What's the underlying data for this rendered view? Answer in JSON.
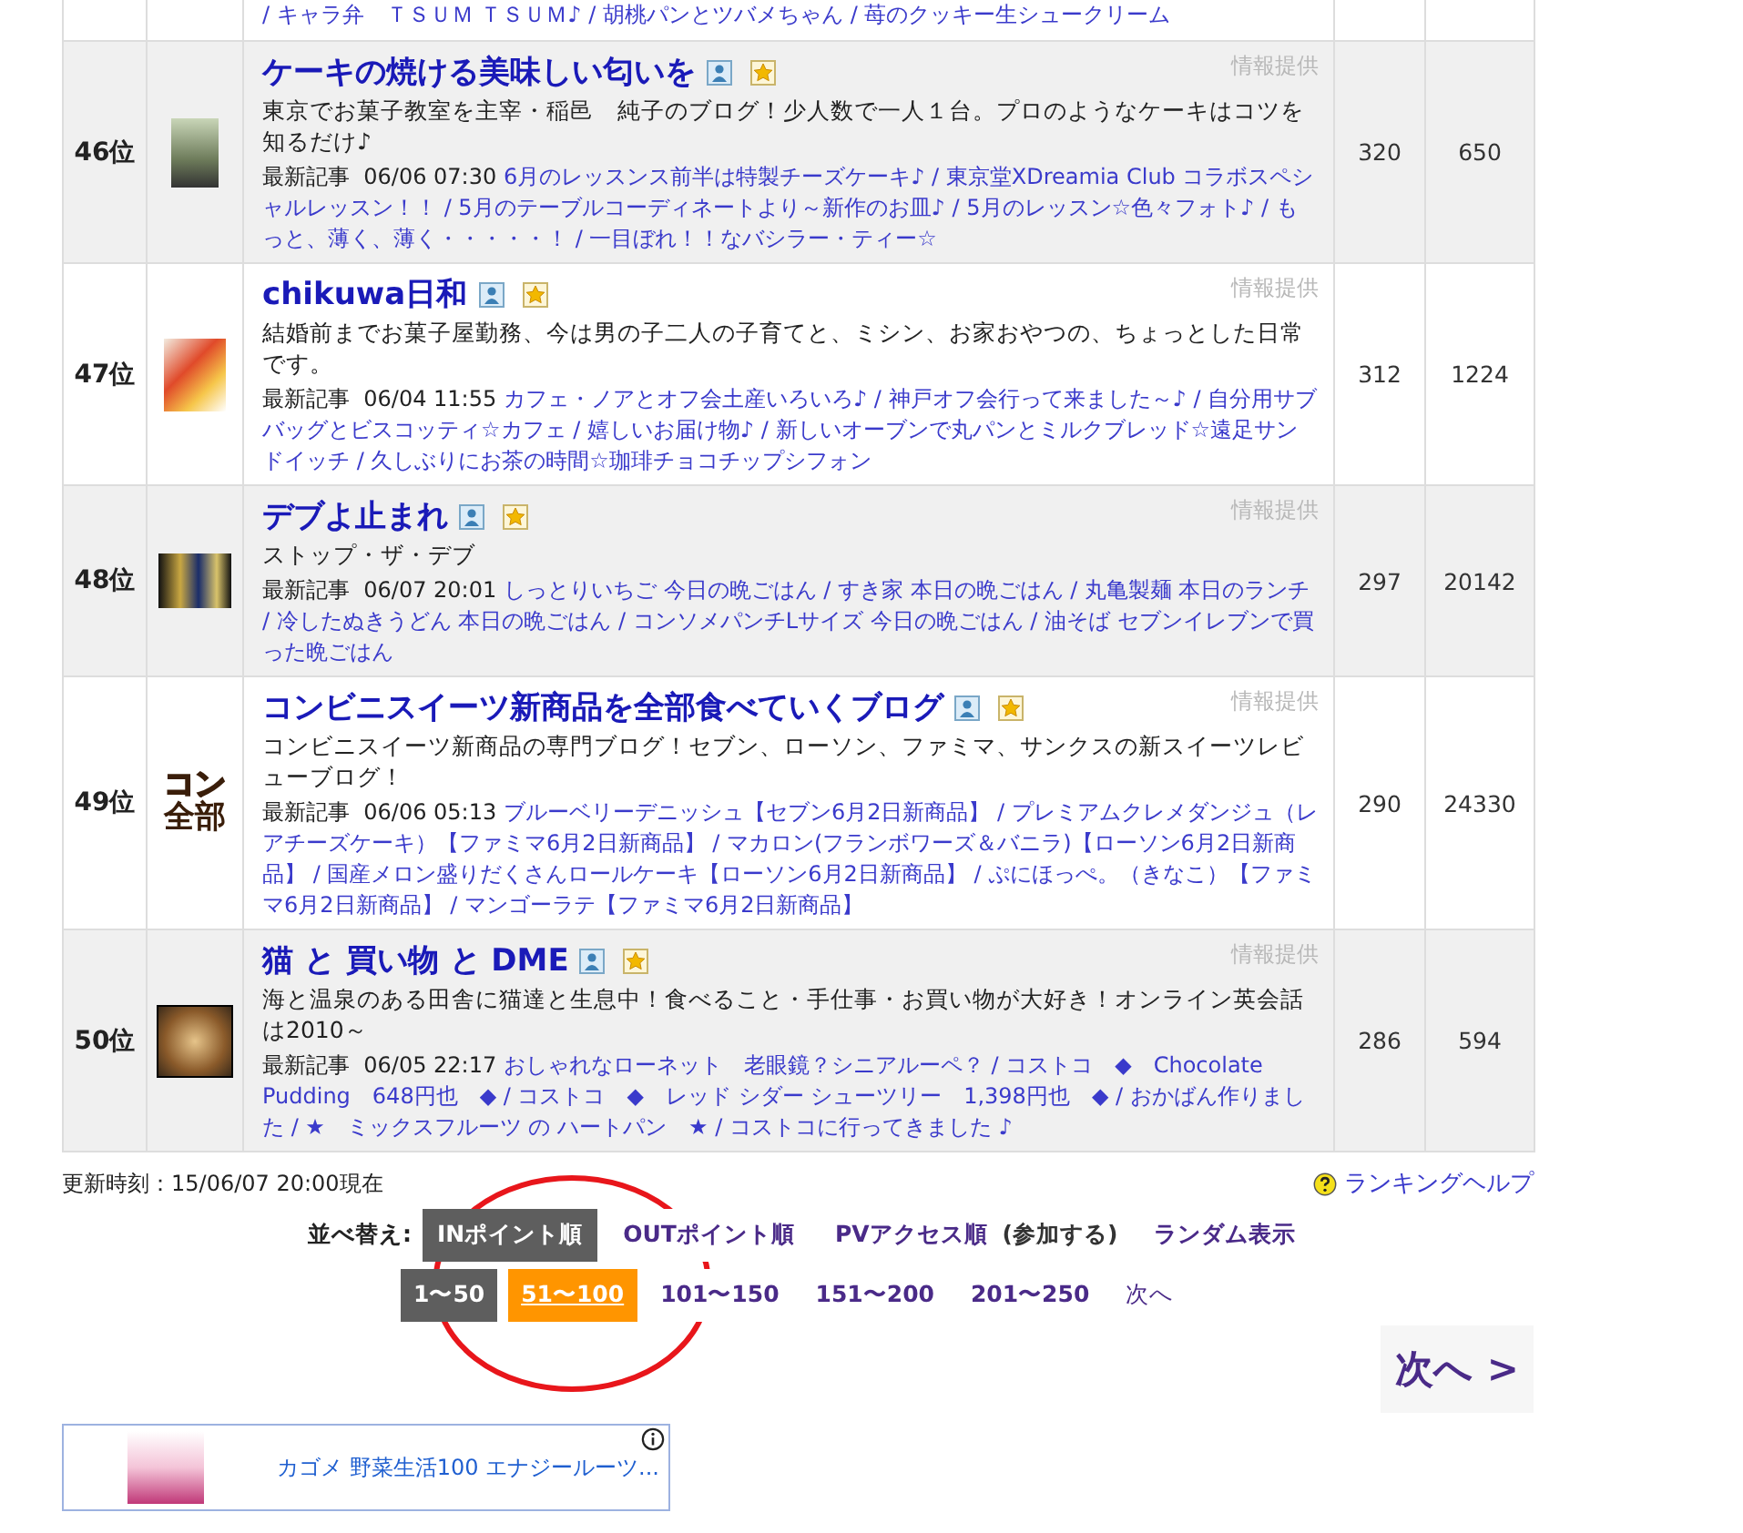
{
  "top_row_tail": "/ キャラ弁　ＴＳＵＭ ＴＳＵＭ♪ / 胡桃パンとツバメちゃん / 苺のクッキー生シュークリーム",
  "rows": [
    {
      "rank": "46位",
      "thumb": {
        "kind": "photo"
      },
      "title": "ケーキの焼ける美味しい匂いを",
      "info": "情報提供",
      "description": "東京でお菓子教室を主宰・稲邑　純子のブログ！少人数で一人１台。プロのようなケーキはコツを知るだけ♪",
      "latest_label": "最新記事",
      "latest_time": "06/06 07:30",
      "articles": "6月のレッスンス前半は特製チーズケーキ♪ / 東京堂XDreamia Club コラボスペシャルレッスン！！ / 5月のテーブルコーディネートより～新作のお皿♪ / 5月のレッスン☆色々フォト♪ / もっと、薄く、薄く・・・・・！ / 一目ぼれ！！なバシラー・ティー☆",
      "in_points": "320",
      "out_points": "650"
    },
    {
      "rank": "47位",
      "thumb": {
        "kind": "photo"
      },
      "title": "chikuwa日和",
      "info": "情報提供",
      "description": "結婚前までお菓子屋勤務、今は男の子二人の子育てと、ミシン、お家おやつの、ちょっとした日常です。",
      "latest_label": "最新記事",
      "latest_time": "06/04 11:55",
      "articles": "カフェ・ノアとオフ会土産いろいろ♪ / 神戸オフ会行って来ました～♪ / 自分用サブバッグとビスコッティ☆カフェ / 嬉しいお届け物♪ / 新しいオーブンで丸パンとミルクブレッド☆遠足サンドイッチ / 久しぶりにお茶の時間☆珈琲チョコチップシフォン",
      "in_points": "312",
      "out_points": "1224"
    },
    {
      "rank": "48位",
      "thumb": {
        "kind": "photo"
      },
      "title": "デブよ止まれ",
      "info": "情報提供",
      "description": "ストップ・ザ・デブ",
      "latest_label": "最新記事",
      "latest_time": "06/07 20:01",
      "articles": "しっとりいちご 今日の晩ごはん / すき家 本日の晩ごはん / 丸亀製麺 本日のランチ / 冷したぬきうどん 本日の晩ごはん / コンソメパンチLサイズ 今日の晩ごはん / 油そば セブンイレブンで買った晩ごはん",
      "in_points": "297",
      "out_points": "20142"
    },
    {
      "rank": "49位",
      "thumb": {
        "kind": "logo",
        "lines": [
          "コン",
          "全部"
        ]
      },
      "title": "コンビニスイーツ新商品を全部食べていくブログ",
      "info": "情報提供",
      "description": "コンビニスイーツ新商品の専門ブログ！セブン、ローソン、ファミマ、サンクスの新スイーツレビューブログ！",
      "latest_label": "最新記事",
      "latest_time": "06/06 05:13",
      "articles": "ブルーベリーデニッシュ【セブン6月2日新商品】 / プレミアムクレメダンジュ（レアチーズケーキ）【ファミマ6月2日新商品】 / マカロン(フランボワーズ＆バニラ)【ローソン6月2日新商品】 / 国産メロン盛りだくさんロールケーキ【ローソン6月2日新商品】 / ぷにほっぺ。（きなこ）【ファミマ6月2日新商品】 / マンゴーラテ【ファミマ6月2日新商品】",
      "in_points": "290",
      "out_points": "24330"
    },
    {
      "rank": "50位",
      "thumb": {
        "kind": "photo"
      },
      "title": "猫 と 買い物 と DME",
      "info": "情報提供",
      "description": "海と温泉のある田舎に猫達と生息中！食べること・手仕事・お買い物が大好き！オンライン英会話は2010～",
      "latest_label": "最新記事",
      "latest_time": "06/05 22:17",
      "articles": "おしゃれなローネット　老眼鏡？シニアルーペ？ / コストコ　◆　Chocolate Pudding　648円也　◆ / コストコ　◆　レッド シダー シューツリー　1,398円也　◆ / おかばん作りました / ★　ミックスフルーツ の ハートパン　★ / コストコに行ってきました ♪",
      "in_points": "286",
      "out_points": "594"
    }
  ],
  "updated": "更新時刻：15/06/07 20:00現在",
  "help_link": "ランキングヘルプ",
  "sort": {
    "label": "並べ替え:",
    "options": [
      {
        "label": "INポイント順",
        "selected": true
      },
      {
        "label": "OUTポイント順",
        "selected": false
      },
      {
        "label": "PVアクセス順",
        "selected": false,
        "note": "(参加する)"
      },
      {
        "label": "ランダム表示",
        "selected": false
      }
    ]
  },
  "pages": [
    {
      "label": "1〜50",
      "kind": "first"
    },
    {
      "label": "51〜100",
      "kind": "current"
    },
    {
      "label": "101〜150",
      "kind": "plain"
    },
    {
      "label": "151〜200",
      "kind": "plain"
    },
    {
      "label": "201〜250",
      "kind": "plain"
    },
    {
      "label": "次へ",
      "kind": "next"
    }
  ],
  "next_button": "次へ >",
  "ad": {
    "text": "カゴメ 野菜生活100 エナジールーツ..."
  }
}
